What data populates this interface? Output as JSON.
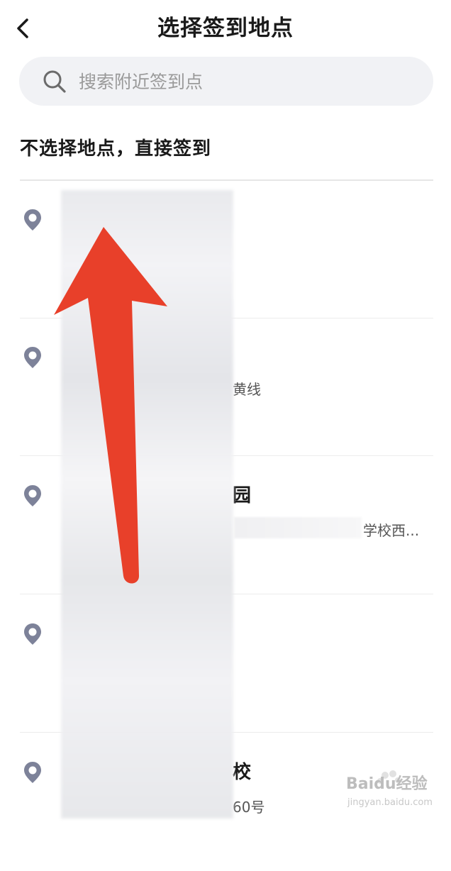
{
  "header": {
    "back_icon": "chevron-left-icon",
    "title": "选择签到地点"
  },
  "search": {
    "icon": "search-icon",
    "placeholder": "搜索附近签到点",
    "value": ""
  },
  "no_location_option": "不选择地点，直接签到",
  "locations": [
    {
      "name": "",
      "address": "",
      "pin_icon": "location-pin-icon"
    },
    {
      "name": "",
      "address": "黄线",
      "pin_icon": "location-pin-icon"
    },
    {
      "name": "园",
      "address": "学校西...",
      "pin_icon": "location-pin-icon"
    },
    {
      "name": "",
      "address": "",
      "pin_icon": "location-pin-icon"
    },
    {
      "name": "校",
      "address": "60号",
      "pin_icon": "location-pin-icon"
    }
  ],
  "watermark": {
    "logo_text": "Baidu经验",
    "url_text": "jingyan.baidu.com"
  },
  "colors": {
    "arrow": "#e8402a",
    "pin": "#7d8299",
    "search_bg": "#f1f2f5"
  }
}
